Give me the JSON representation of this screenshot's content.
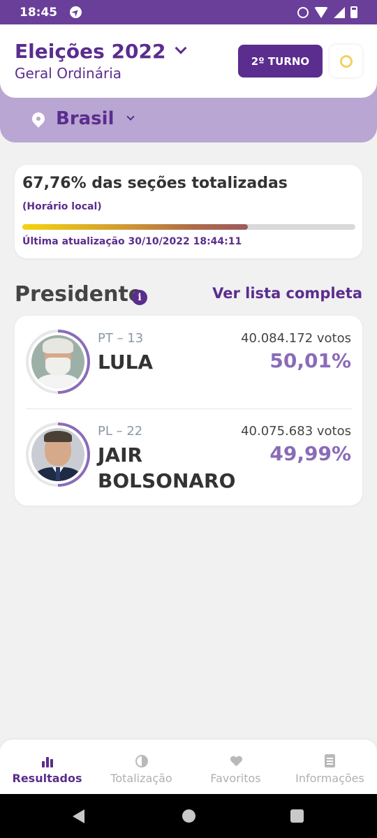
{
  "status_bar": {
    "time": "18:45"
  },
  "header": {
    "title": "Eleições 2022",
    "subtitle": "Geral Ordinária",
    "turn_button": "2º TURNO",
    "theme_toggle_icon": "sun-icon"
  },
  "region": {
    "label": "Brasil",
    "icon": "location-pin-icon"
  },
  "progress": {
    "title": "67,76% das seções totalizadas",
    "local_time_note": "(Horário local)",
    "percent": 67.76,
    "last_update": "Última atualização 30/10/2022 18:44:11"
  },
  "section": {
    "title": "Presidente",
    "info_icon": "info-icon",
    "full_list_link": "Ver lista completa"
  },
  "candidates": [
    {
      "party": "PT – 13",
      "name": "LULA",
      "votes": "40.084.172 votos",
      "percent_label": "50,01%",
      "percent": 50.01
    },
    {
      "party": "PL – 22",
      "name": "JAIR BOLSONARO",
      "votes": "40.075.683 votos",
      "percent_label": "49,99%",
      "percent": 49.99
    }
  ],
  "bottom_nav": [
    {
      "label": "Resultados",
      "icon": "bar-chart-icon",
      "active": true
    },
    {
      "label": "Totalização",
      "icon": "pie-chart-icon",
      "active": false
    },
    {
      "label": "Favoritos",
      "icon": "heart-icon",
      "active": false
    },
    {
      "label": "Informações",
      "icon": "document-icon",
      "active": false
    }
  ],
  "colors": {
    "brand_purple": "#5b2d8e",
    "status_bar": "#6a3f9a",
    "region_band": "#b9a6d2",
    "percent_purple": "#8a6bb8"
  }
}
